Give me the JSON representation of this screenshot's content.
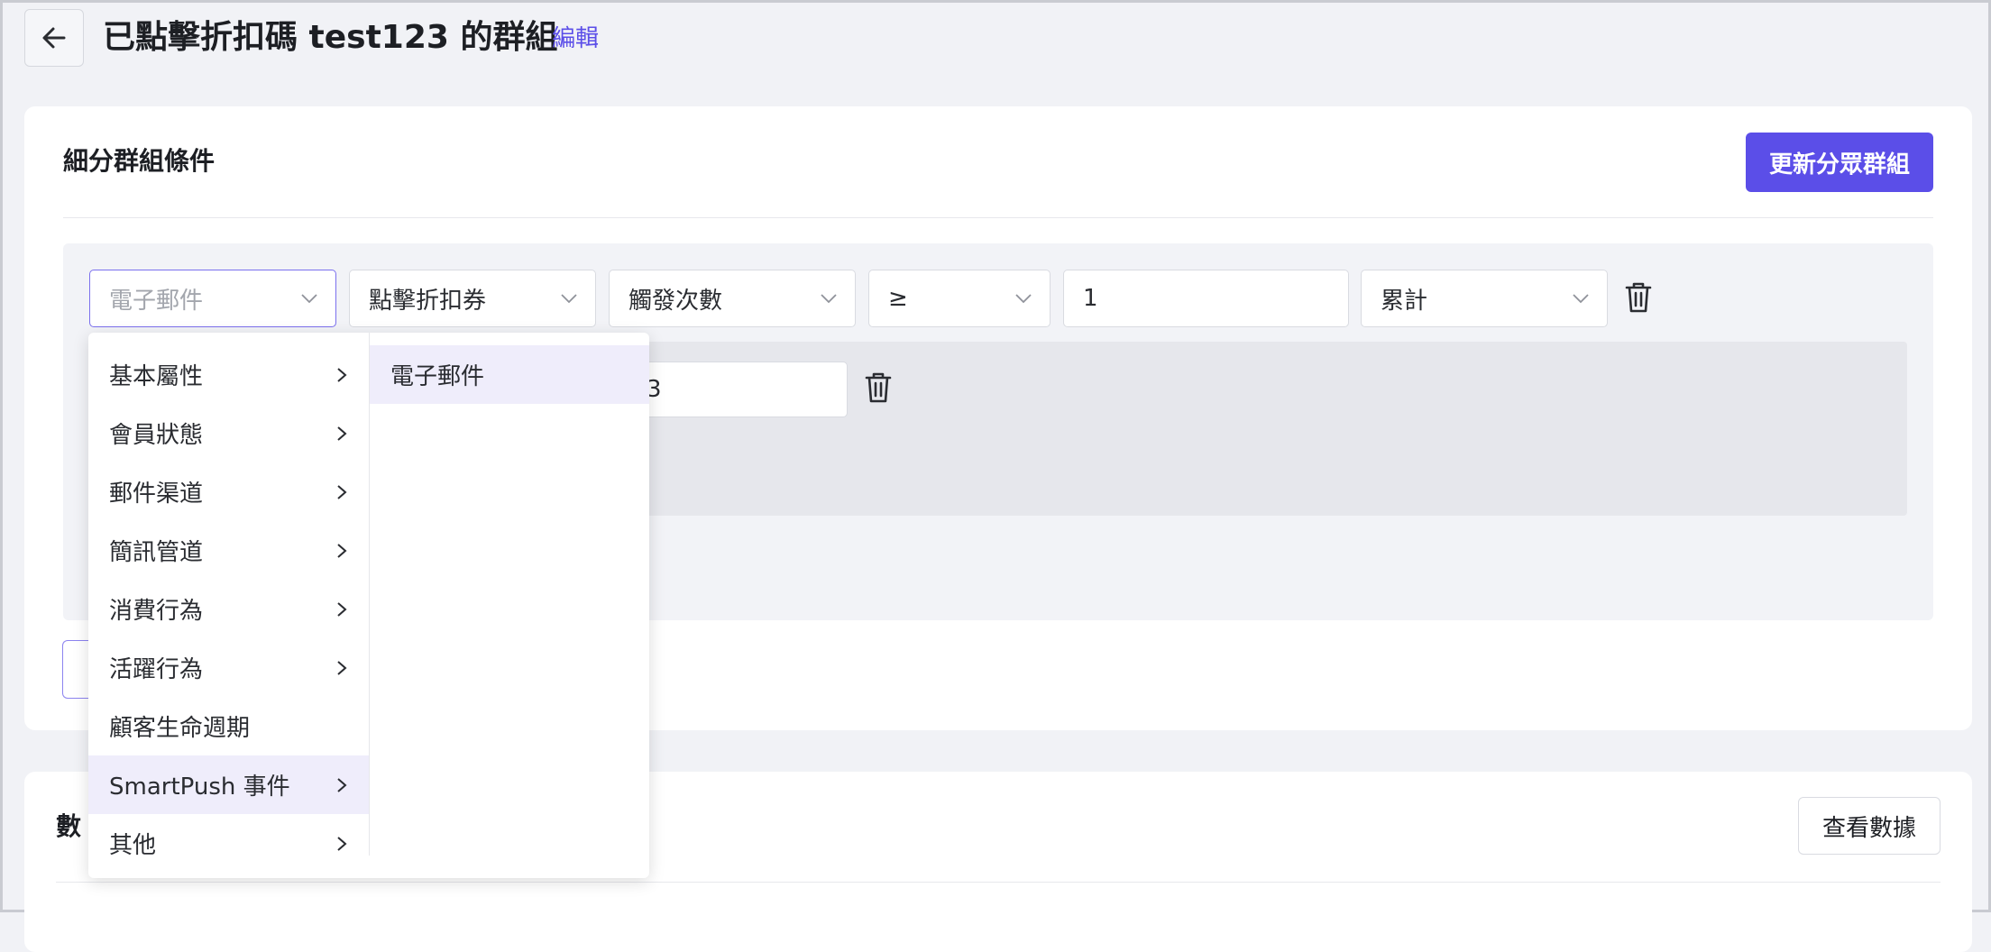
{
  "header": {
    "title": "已點擊折扣碼 test123 的群組",
    "edit_label": "編輯"
  },
  "segment": {
    "title": "細分群組條件",
    "update_button": "更新分眾群組",
    "condition": {
      "channel": "電子郵件",
      "event": "點擊折扣券",
      "metric": "觸發次數",
      "operator": "≥",
      "value": "1",
      "aggregation": "累計"
    },
    "nested_value_partial": "3"
  },
  "stats": {
    "title_partial": "數",
    "view_button": "查看數據"
  },
  "dropdown": {
    "categories": [
      {
        "label": "基本屬性",
        "has_sub": true
      },
      {
        "label": "會員狀態",
        "has_sub": true
      },
      {
        "label": "郵件渠道",
        "has_sub": true
      },
      {
        "label": "簡訊管道",
        "has_sub": true
      },
      {
        "label": "消費行為",
        "has_sub": true
      },
      {
        "label": "活躍行為",
        "has_sub": true
      },
      {
        "label": "顧客生命週期",
        "has_sub": false
      },
      {
        "label": "SmartPush 事件",
        "has_sub": true,
        "active": true
      },
      {
        "label": "其他",
        "has_sub": true
      }
    ],
    "subitems": [
      {
        "label": "電子郵件",
        "active": true
      }
    ]
  },
  "colors": {
    "accent": "#5b4ee8",
    "menu_highlight": "#efedfb",
    "page_bg": "#f1f2f6"
  }
}
